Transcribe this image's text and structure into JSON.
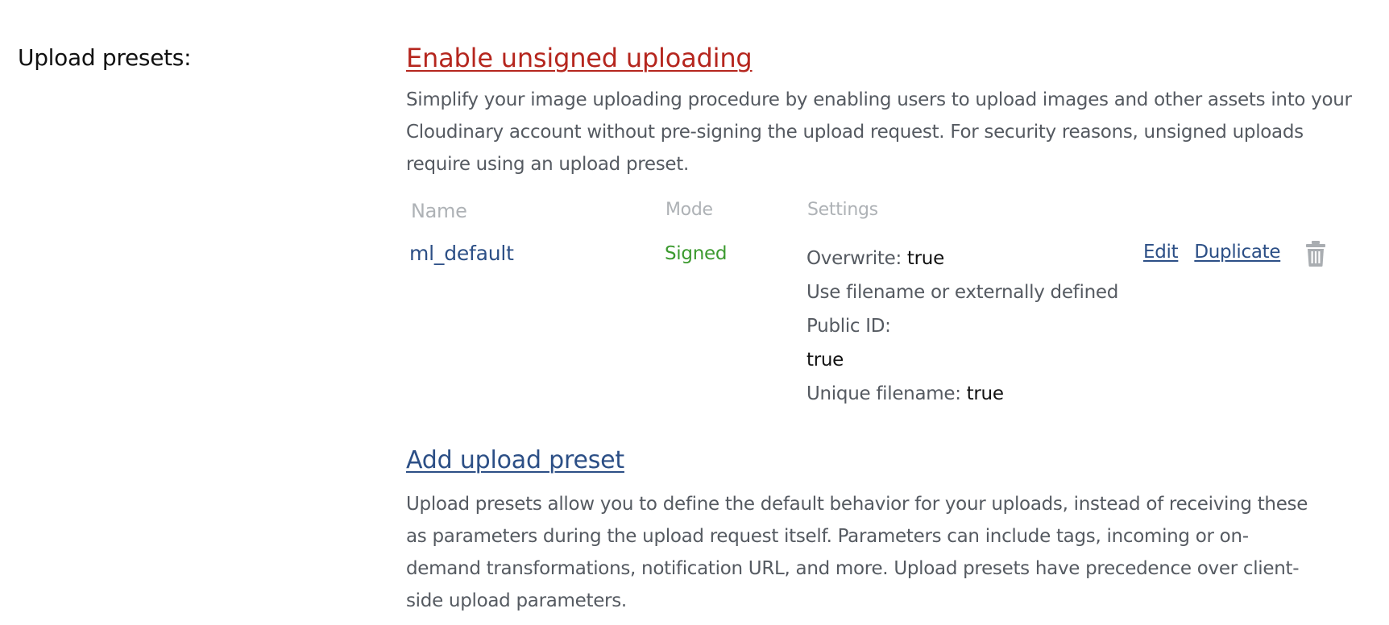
{
  "section": {
    "label": "Upload presets:"
  },
  "unsigned": {
    "link_label": "Enable unsigned uploading",
    "description": "Simplify your image uploading procedure by enabling users to upload images and other assets into your Cloudinary account without pre-signing the upload request. For security reasons, unsigned uploads require using an upload preset."
  },
  "table": {
    "headers": {
      "name": "Name",
      "mode": "Mode",
      "settings": "Settings"
    },
    "rows": [
      {
        "name": "ml_default",
        "mode": "Signed",
        "settings": {
          "overwrite_label": "Overwrite:",
          "overwrite_value": "true",
          "filename_label_line1": "Use filename or externally defined",
          "filename_label_line2": "Public ID:",
          "filename_value": "true",
          "unique_label": "Unique filename:",
          "unique_value": "true"
        },
        "actions": {
          "edit_label": "Edit",
          "duplicate_label": "Duplicate",
          "delete_icon": "trash-icon"
        }
      }
    ]
  },
  "add_preset": {
    "link_label": "Add upload preset",
    "description": "Upload presets allow you to define the default behavior for your uploads, instead of receiving these as parameters during the upload request itself. Parameters can include tags, incoming or on-demand transformations, notification URL, and more. Upload presets have precedence over client-side upload parameters."
  },
  "colors": {
    "enable_link": "#b5261e",
    "link": "#2c4f86",
    "mode_signed": "#3c9a2f",
    "header_text": "#aeb2b6",
    "body_text": "#555a61"
  }
}
